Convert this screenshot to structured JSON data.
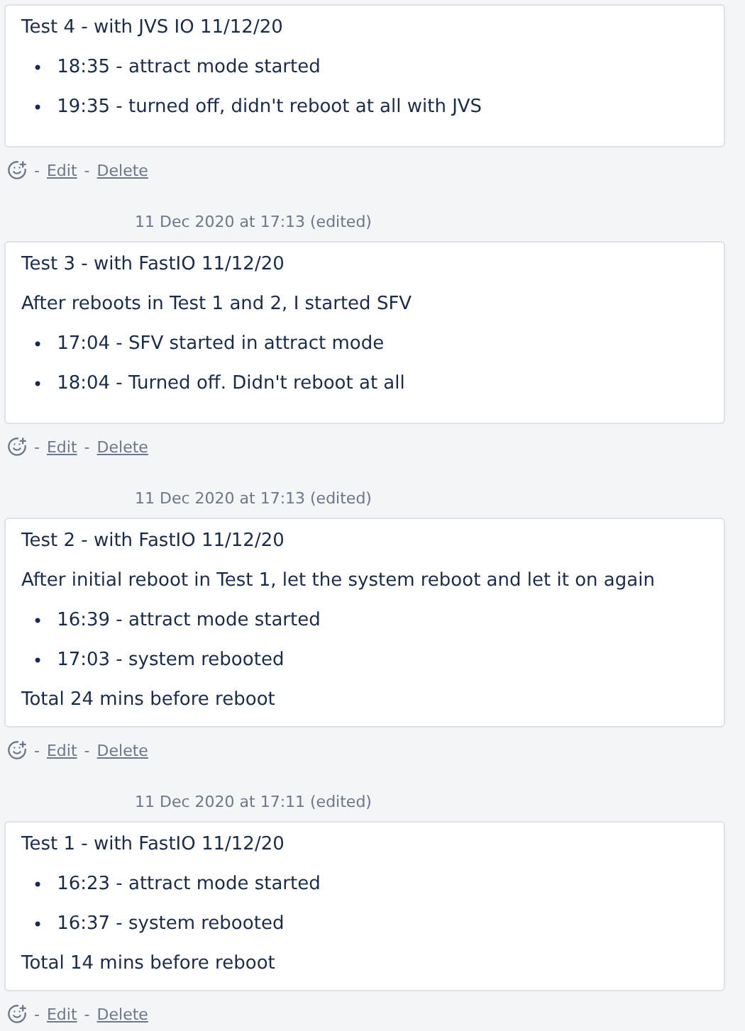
{
  "comments": [
    {
      "blocks": [
        {
          "kind": "paragraph",
          "text": "Test 4 - with JVS IO 11/12/20"
        },
        {
          "kind": "list",
          "bullet": "•",
          "items": [
            "18:35 - attract mode started",
            "19:35 - turned off, didn't reboot at all with JVS"
          ]
        }
      ],
      "actions": {
        "separator": "-",
        "edit": "Edit",
        "delete": "Delete"
      }
    },
    {
      "timestamp": "11 Dec 2020 at 17:13 (edited)",
      "blocks": [
        {
          "kind": "paragraph",
          "text": "Test 3 - with FastIO 11/12/20"
        },
        {
          "kind": "paragraph",
          "text": "After reboots in Test 1 and 2, I started SFV"
        },
        {
          "kind": "list",
          "bullet": "•",
          "items": [
            "17:04 - SFV started in attract mode",
            "18:04 - Turned off. Didn't reboot at all"
          ]
        }
      ],
      "actions": {
        "separator": "-",
        "edit": "Edit",
        "delete": "Delete"
      }
    },
    {
      "timestamp": "11 Dec 2020 at 17:13 (edited)",
      "blocks": [
        {
          "kind": "paragraph",
          "text": "Test 2 - with FastIO 11/12/20"
        },
        {
          "kind": "paragraph",
          "text": "After initial reboot in Test 1, let the system reboot and let it on again"
        },
        {
          "kind": "list",
          "bullet": "•",
          "items": [
            "16:39 - attract mode started",
            "17:03 - system rebooted"
          ]
        },
        {
          "kind": "paragraph",
          "text": "Total 24 mins before reboot"
        }
      ],
      "actions": {
        "separator": "-",
        "edit": "Edit",
        "delete": "Delete"
      }
    },
    {
      "timestamp": "11 Dec 2020 at 17:11 (edited)",
      "blocks": [
        {
          "kind": "paragraph",
          "text": "Test 1 - with FastIO 11/12/20"
        },
        {
          "kind": "list",
          "bullet": "•",
          "items": [
            "16:23 - attract mode started",
            "16:37 - system rebooted"
          ]
        },
        {
          "kind": "paragraph",
          "text": "Total 14 mins before reboot"
        }
      ],
      "actions": {
        "separator": "-",
        "edit": "Edit",
        "delete": "Delete"
      }
    }
  ]
}
